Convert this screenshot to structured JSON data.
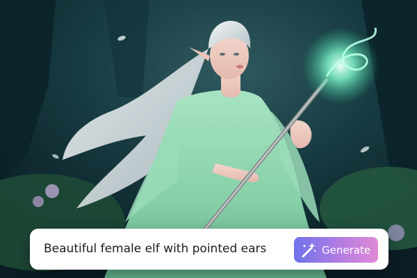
{
  "prompt": {
    "text": "Beautiful female elf with pointed ears"
  },
  "generate_button": {
    "label": "Generate",
    "icon": "magic-wand-icon",
    "gradient_start": "#6f73ec",
    "gradient_end": "#e08ad6"
  },
  "scene": {
    "subject": "elf-image",
    "palette": {
      "forest_dark": "#0f2a33",
      "dress": "#8fd6b0",
      "hair": "#e6ecef",
      "staff_glow": "#7ff2c8"
    }
  }
}
